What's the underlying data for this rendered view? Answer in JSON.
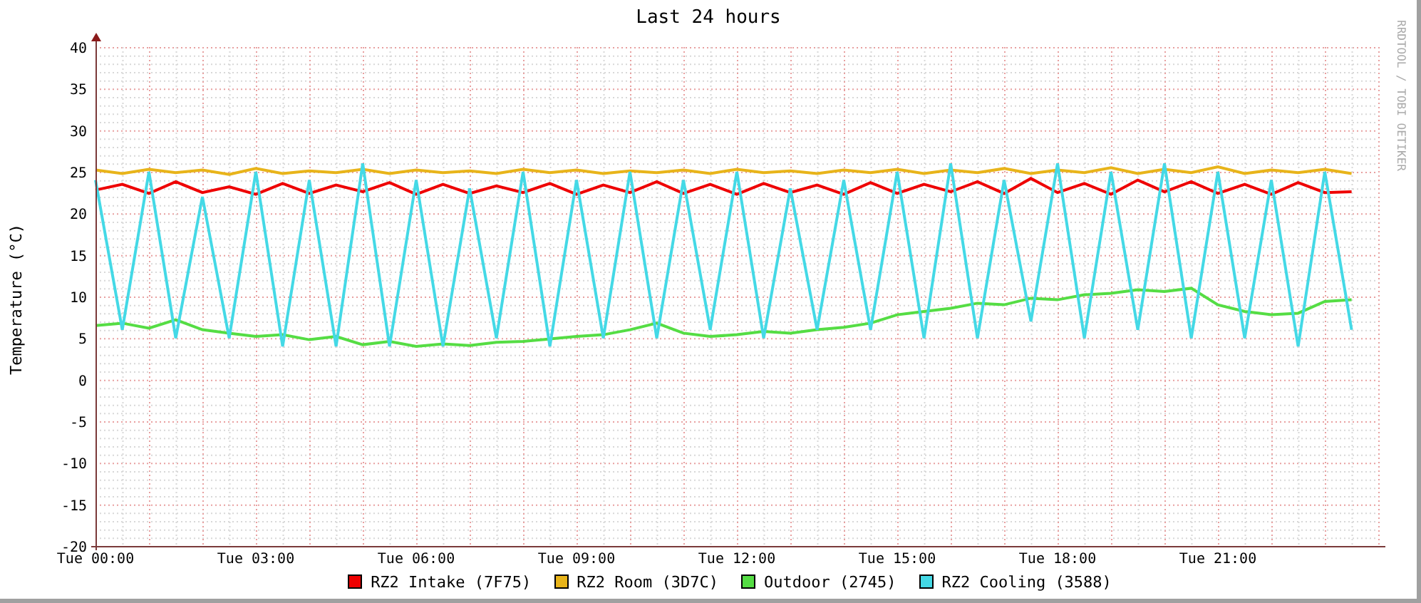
{
  "chart_data": {
    "type": "line",
    "title": "Last 24 hours",
    "ylabel": "Temperature (°C)",
    "categories": [
      "Tue 00:00",
      null,
      null,
      null,
      null,
      null,
      "Tue 03:00",
      null,
      null,
      null,
      null,
      null,
      "Tue 06:00",
      null,
      null,
      null,
      null,
      null,
      "Tue 09:00",
      null,
      null,
      null,
      null,
      null,
      "Tue 12:00",
      null,
      null,
      null,
      null,
      null,
      "Tue 15:00",
      null,
      null,
      null,
      null,
      null,
      "Tue 18:00",
      null,
      null,
      null,
      null,
      null,
      "Tue 21:00",
      null,
      null,
      null,
      null,
      null
    ],
    "ylim": [
      -20,
      40
    ],
    "grid": true,
    "yticks": [
      -20,
      -15,
      -10,
      -5,
      0,
      5,
      10,
      15,
      20,
      25,
      30,
      35,
      40
    ],
    "series": [
      {
        "name": "RZ2 Intake (7F75)",
        "color": "#ee0000",
        "values": [
          22.8,
          23.5,
          22.4,
          23.8,
          22.5,
          23.2,
          22.3,
          23.6,
          22.4,
          23.4,
          22.6,
          23.7,
          22.3,
          23.5,
          22.4,
          23.3,
          22.5,
          23.6,
          22.3,
          23.4,
          22.5,
          23.8,
          22.4,
          23.5,
          22.3,
          23.6,
          22.5,
          23.4,
          22.3,
          23.7,
          22.4,
          23.5,
          22.6,
          23.8,
          22.4,
          24.2,
          22.5,
          23.6,
          22.3,
          24.0,
          22.6,
          23.8,
          22.4,
          23.5,
          22.3,
          23.7,
          22.5,
          22.6
        ]
      },
      {
        "name": "RZ2 Room (3D7C)",
        "color": "#e8b41a",
        "values": [
          25.2,
          24.8,
          25.3,
          24.9,
          25.2,
          24.7,
          25.4,
          24.8,
          25.1,
          24.9,
          25.3,
          24.8,
          25.2,
          24.9,
          25.1,
          24.8,
          25.3,
          24.9,
          25.2,
          24.8,
          25.1,
          24.9,
          25.2,
          24.8,
          25.3,
          24.9,
          25.1,
          24.8,
          25.2,
          24.9,
          25.3,
          24.8,
          25.2,
          24.9,
          25.4,
          24.8,
          25.2,
          24.9,
          25.5,
          24.8,
          25.3,
          24.9,
          25.6,
          24.8,
          25.2,
          24.9,
          25.3,
          24.8
        ]
      },
      {
        "name": "Outdoor (2745)",
        "color": "#55dd44",
        "values": [
          6.5,
          6.8,
          6.2,
          7.2,
          6.0,
          5.6,
          5.2,
          5.4,
          4.8,
          5.2,
          4.2,
          4.6,
          4.0,
          4.3,
          4.1,
          4.5,
          4.6,
          4.9,
          5.2,
          5.4,
          6.0,
          6.8,
          5.6,
          5.2,
          5.4,
          5.8,
          5.6,
          6.0,
          6.3,
          6.8,
          7.8,
          8.2,
          8.6,
          9.2,
          9.0,
          9.8,
          9.6,
          10.2,
          10.4,
          10.8,
          10.6,
          11.0,
          9.0,
          8.2,
          7.8,
          8.0,
          9.4,
          9.6
        ]
      },
      {
        "name": "RZ2 Cooling (3588)",
        "color": "#44d9e6",
        "values": [
          24,
          6,
          25,
          5,
          22,
          5,
          25,
          4,
          24,
          4,
          26,
          4,
          24,
          4,
          23,
          5,
          25,
          4,
          24,
          5,
          25,
          5,
          24,
          6,
          25,
          5,
          23,
          6,
          24,
          6,
          25,
          5,
          26,
          5,
          24,
          7,
          26,
          5,
          25,
          6,
          26,
          5,
          25,
          5,
          24,
          4,
          25,
          6
        ]
      }
    ]
  },
  "credit": "RRDTOOL / TOBI OETIKER"
}
